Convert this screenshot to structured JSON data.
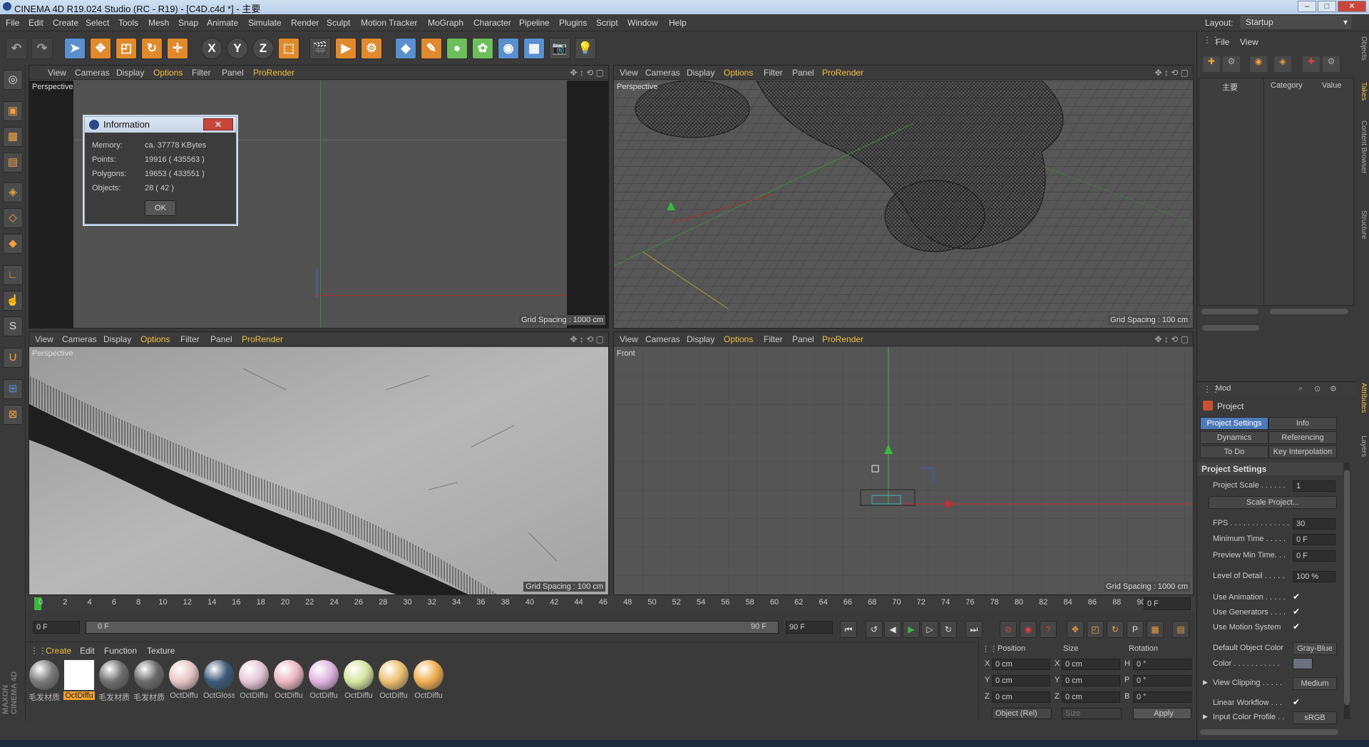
{
  "window": {
    "title": "CINEMA 4D R19.024 Studio (RC - R19) - [C4D.c4d *] - 主要"
  },
  "menu": [
    "File",
    "Edit",
    "Create",
    "Select",
    "Tools",
    "Mesh",
    "Snap",
    "Animate",
    "Simulate",
    "Render",
    "Sculpt",
    "Motion Tracker",
    "MoGraph",
    "Character",
    "Pipeline",
    "Plugins",
    "Script",
    "Window",
    "Help"
  ],
  "layout": {
    "label": "Layout:",
    "value": "Startup"
  },
  "toolbar": {
    "x": "X",
    "y": "Y",
    "z": "Z"
  },
  "viewport_menu": {
    "view": "View",
    "cameras": "Cameras",
    "display": "Display",
    "options": "Options",
    "filter": "Filter",
    "panel": "Panel",
    "prorender": "ProRender"
  },
  "viewports": {
    "top_left": {
      "label": "Perspective",
      "grid": "Grid Spacing : 1000 cm"
    },
    "top_right": {
      "label": "Perspective",
      "grid": "Grid Spacing : 100 cm"
    },
    "bottom_left": {
      "label": "Perspective",
      "grid": "Grid Spacing : 100 cm"
    },
    "bottom_right": {
      "label": "Front",
      "grid": "Grid Spacing : 1000 cm"
    }
  },
  "info_dialog": {
    "title": "Information",
    "memory_label": "Memory:",
    "memory": "ca. 37778 KBytes",
    "points_label": "Points:",
    "points": "19916 ( 435563 )",
    "polygons_label": "Polygons:",
    "polygons": "19653 ( 433551 )",
    "objects_label": "Objects:",
    "objects": "28 ( 42 )",
    "ok": "OK"
  },
  "timeline": {
    "ticks": [
      "0",
      "2",
      "4",
      "6",
      "8",
      "10",
      "12",
      "14",
      "16",
      "18",
      "20",
      "22",
      "24",
      "26",
      "28",
      "30",
      "32",
      "34",
      "36",
      "38",
      "40",
      "42",
      "44",
      "46",
      "48",
      "50",
      "52",
      "54",
      "56",
      "58",
      "60",
      "62",
      "64",
      "66",
      "68",
      "70",
      "72",
      "74",
      "76",
      "78",
      "80",
      "82",
      "84",
      "86",
      "88",
      "90"
    ],
    "current": "0 F",
    "start": "0 F",
    "min": "0 F",
    "max": "90 F",
    "end": "90 F"
  },
  "materials": {
    "menu": [
      "Create",
      "Edit",
      "Function",
      "Texture"
    ],
    "items": [
      {
        "name": "毛发材质",
        "color": "#7a7a7a"
      },
      {
        "name": "OctDiffu",
        "color": "#ffffff"
      },
      {
        "name": "毛发材质",
        "color": "#6e6e6e"
      },
      {
        "name": "毛发材质",
        "color": "#6a6a6a"
      },
      {
        "name": "OctDiffu",
        "color": "#e8c4c4"
      },
      {
        "name": "OctGloss",
        "color": "#3d5a7a"
      },
      {
        "name": "OctDiffu",
        "color": "#e6c6d6"
      },
      {
        "name": "OctDiffu",
        "color": "#ecb8c4"
      },
      {
        "name": "OctDiffu",
        "color": "#e0b4e0"
      },
      {
        "name": "OctDiffu",
        "color": "#d6e6a0"
      },
      {
        "name": "OctDiffu",
        "color": "#ecc070"
      },
      {
        "name": "OctDiffu",
        "color": "#f0b050"
      }
    ]
  },
  "coords": {
    "position": "Position",
    "size": "Size",
    "rotation": "Rotation",
    "x": "X",
    "y": "Y",
    "z": "Z",
    "h": "H",
    "p": "P",
    "b": "B",
    "px": "0 cm",
    "py": "0 cm",
    "pz": "0 cm",
    "sx": "0 cm",
    "sy": "0 cm",
    "sz": "0 cm",
    "rh": "0 °",
    "rp": "0 °",
    "rb": "0 °",
    "mode": "Object (Rel)",
    "size_mode": "Size",
    "apply": "Apply"
  },
  "objects_panel": {
    "file": "File",
    "view": "View",
    "root": "主要",
    "category": "Category",
    "value": "Value"
  },
  "attributes": {
    "mode": "Mod",
    "project": "Project",
    "tabs": [
      "Project Settings",
      "Info",
      "Dynamics",
      "Referencing",
      "To Do",
      "Key Interpolation"
    ],
    "section": "Project Settings",
    "project_scale_label": "Project Scale . . . . . .",
    "project_scale": "1",
    "scale_project": "Scale Project...",
    "fps_label": "FPS . . . . . . . . . . . . . .",
    "fps": "30",
    "min_time_label": "Minimum Time . . . . .",
    "min_time": "0 F",
    "preview_min_label": "Preview Min Time. . .",
    "preview_min": "0 F",
    "lod_label": "Level of Detail . . . . .",
    "lod": "100 %",
    "use_animation": "Use Animation . . . . .",
    "use_generators": "Use Generators . . . .",
    "use_motion": "Use Motion System",
    "default_color_label": "Default Object Color",
    "default_color": "Gray-Blue",
    "color_label": "Color . . . . . . . . . . .",
    "view_clipping_label": "View Clipping . . . . .",
    "view_clipping": "Medium",
    "linear_workflow": "Linear Workflow . . .",
    "input_profile_label": "Input Color Profile . .",
    "input_profile": "sRGB"
  },
  "side_tabs": [
    "Objects",
    "Takes",
    "Content Browser",
    "Structure",
    "Attributes",
    "Layers"
  ],
  "brand": "MAXON CINEMA 4D",
  "colors": {
    "accent": "#f0c040",
    "selected": "#4d79b8"
  }
}
